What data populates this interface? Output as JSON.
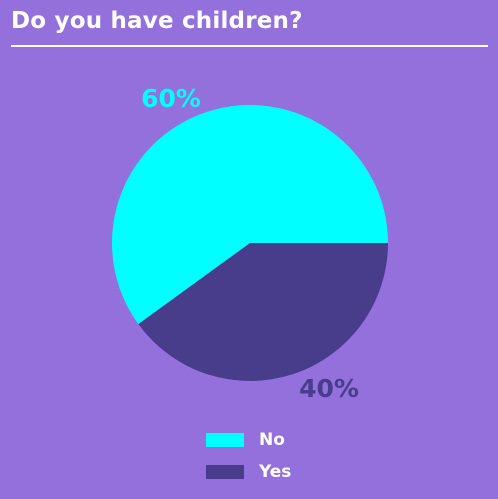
{
  "page": {
    "background": "#9370db"
  },
  "chart_data": {
    "type": "pie",
    "title": "Do you have children?",
    "slices": [
      {
        "label": "No",
        "value": 60,
        "display": "60%",
        "color": "#00ffff"
      },
      {
        "label": "Yes",
        "value": 40,
        "display": "40%",
        "color": "#483d8b"
      }
    ],
    "legend": {
      "placement": "bottom"
    }
  }
}
